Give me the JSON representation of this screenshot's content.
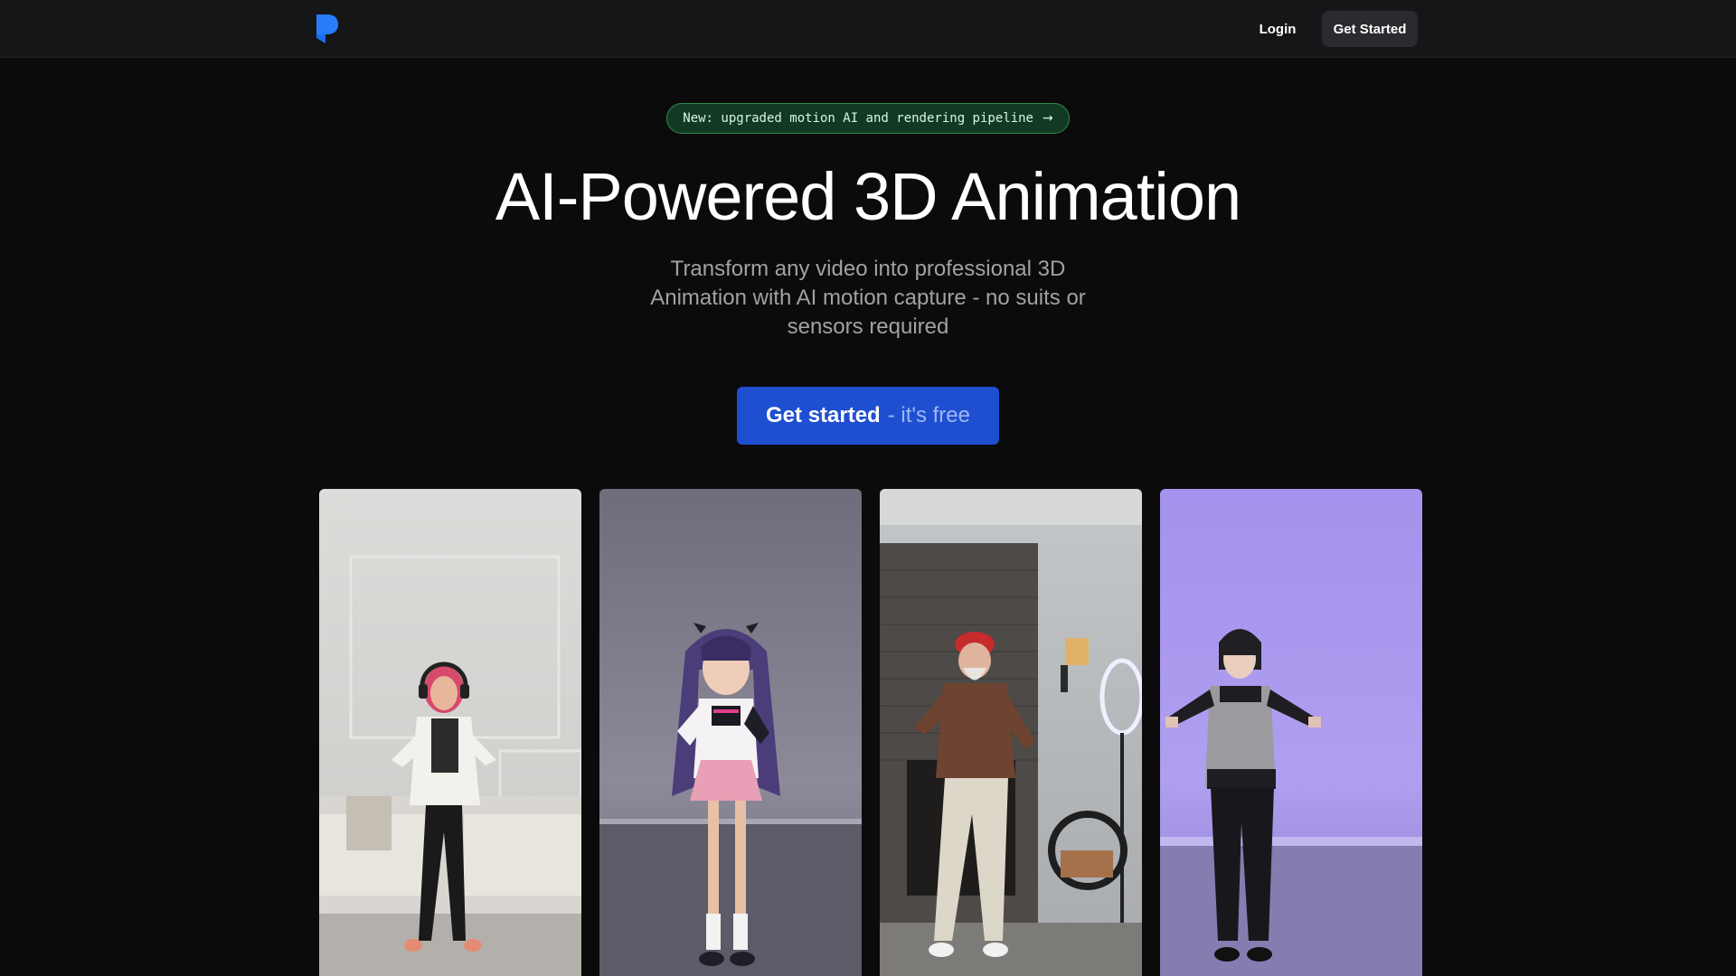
{
  "nav": {
    "logo_icon": "brand-logo-icon",
    "login_label": "Login",
    "get_started_label": "Get Started"
  },
  "announcement": {
    "text": "New: upgraded motion AI and rendering pipeline",
    "arrow": "→"
  },
  "hero": {
    "title": "AI-Powered 3D Animation",
    "subtitle": "Transform any video into professional 3D Animation with AI motion capture - no suits or sensors required",
    "cta_main": "Get started",
    "cta_sub": "- it's free"
  },
  "gallery": {
    "items": [
      {
        "type": "video-frame",
        "scene": "woman-dancing-living-room"
      },
      {
        "type": "3d-render",
        "scene": "anime-girl-character"
      },
      {
        "type": "video-frame",
        "scene": "man-dancing-fireplace"
      },
      {
        "type": "3d-render",
        "scene": "anime-boy-character"
      }
    ]
  },
  "colors": {
    "background": "#0b0b0c",
    "navbar": "#151618",
    "accent_blue": "#1f4fd1",
    "logo_blue": "#1c6cf0",
    "badge_green_bg": "#123a22",
    "badge_green_border": "#2f8a4d"
  }
}
